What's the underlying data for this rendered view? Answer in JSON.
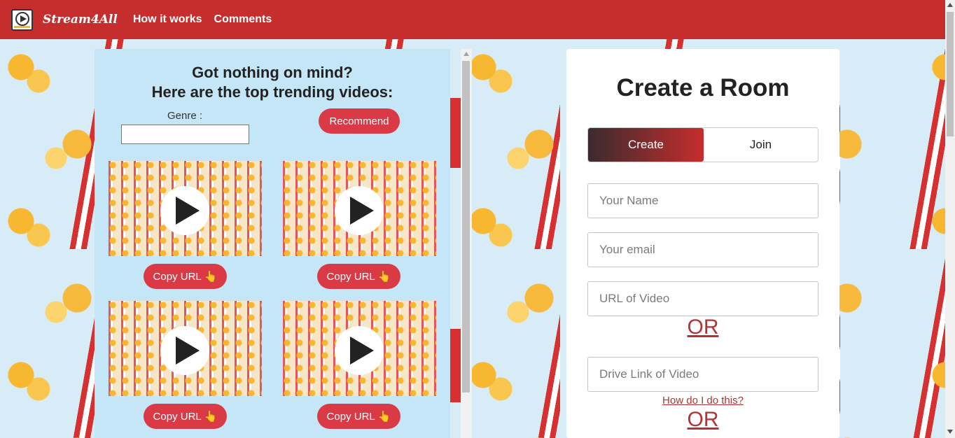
{
  "nav": {
    "brand": "Stream4All",
    "links": [
      "How it works",
      "Comments"
    ]
  },
  "trending": {
    "title_line1": "Got nothing on mind?",
    "title_line2": "Here are the top trending videos:",
    "genre_label": "Genre :",
    "genre_value": "",
    "recommend_label": "Recommend",
    "copy_label": "Copy URL",
    "hand_icon": "👆"
  },
  "room": {
    "title": "Create a Room",
    "tab_create": "Create",
    "tab_join": "Join",
    "name_placeholder": "Your Name",
    "email_placeholder": "Your email",
    "url_placeholder": "URL of Video",
    "or_label": "OR",
    "drive_placeholder": "Drive Link of Video",
    "howto_label": "How do I do this?"
  },
  "colors": {
    "navbar": "#c62d2d",
    "accent": "#d93a46",
    "panel": "#c5e6f7"
  }
}
